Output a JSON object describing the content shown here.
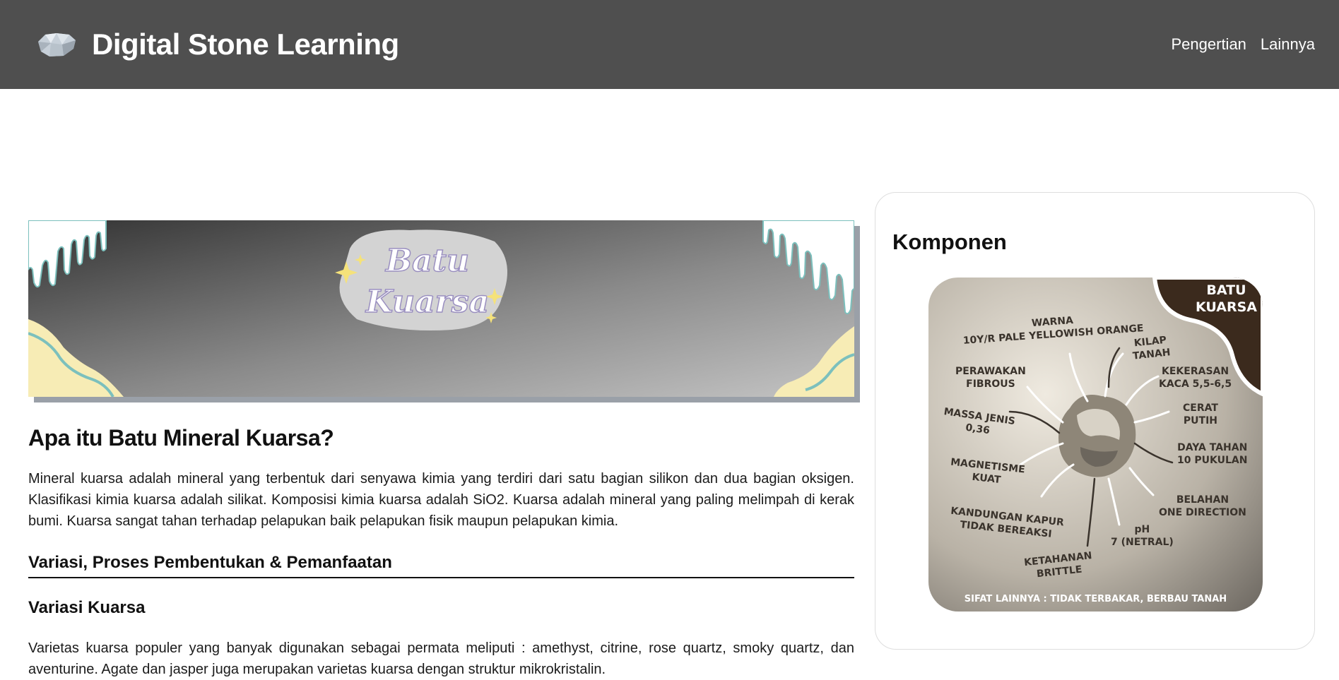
{
  "navbar": {
    "brand_title": "Digital Stone Learning",
    "logo_icon": "quartz-stone-icon",
    "links": [
      "Pengertian",
      "Lainnya"
    ]
  },
  "banner": {
    "line1": "Batu",
    "line2": "Kuarsa"
  },
  "article": {
    "title": "Apa itu Batu Mineral Kuarsa?",
    "intro": "Mineral kuarsa adalah mineral yang terbentuk dari senyawa kimia yang terdiri dari satu bagian silikon dan dua bagian oksigen. Klasifikasi kimia kuarsa adalah silikat. Komposisi kimia kuarsa adalah SiO2. Kuarsa adalah mineral yang paling melimpah di kerak bumi. Kuarsa sangat tahan terhadap pelapukan baik pelapukan fisik maupun pelapukan kimia.",
    "section_title": "Variasi, Proses Pembentukan & Pemanfaatan",
    "subsection_title": "Variasi Kuarsa",
    "variations": "Varietas kuarsa populer yang banyak digunakan sebagai permata meliputi : amethyst, citrine, rose quartz, smoky quartz, dan aventurine. Agate dan jasper juga merupakan varietas kuarsa dengan struktur mikrokristalin."
  },
  "sidebar": {
    "title": "Komponen",
    "infographic": {
      "corner": "BATU\nKUARSA",
      "warna": "WARNA\n10Y/R PALE YELLOWISH ORANGE",
      "kilap": "KILAP\nTANAH",
      "perawakan": "PERAWAKAN\nFIBROUS",
      "kekerasan": "KEKERASAN\nKACA 5,5-6,5",
      "massa": "MASSA JENIS\n0,36",
      "cerat": "CERAT\nPUTIH",
      "magnetisme": "MAGNETISME\nKUAT",
      "daya": "DAYA TAHAN\n10 PUKULAN",
      "kapur": "KANDUNGAN KAPUR\nTIDAK BEREAKSI",
      "belahan": "BELAHAN\nONE DIRECTION",
      "ph": "pH\n7 (NETRAL)",
      "ketahanan": "KETAHANAN\nBRITTLE",
      "footer": "SIFAT LAINNYA : TIDAK TERBAKAR, BERBAU TANAH"
    }
  },
  "colors": {
    "navbar": "#4f4f4f",
    "banner_dark": "#3a3a3a",
    "banner_light": "#b5b5b5",
    "cream": "#f7ecb5",
    "teal": "#7cc0bd",
    "infographic_brown": "#3b2a1d"
  }
}
